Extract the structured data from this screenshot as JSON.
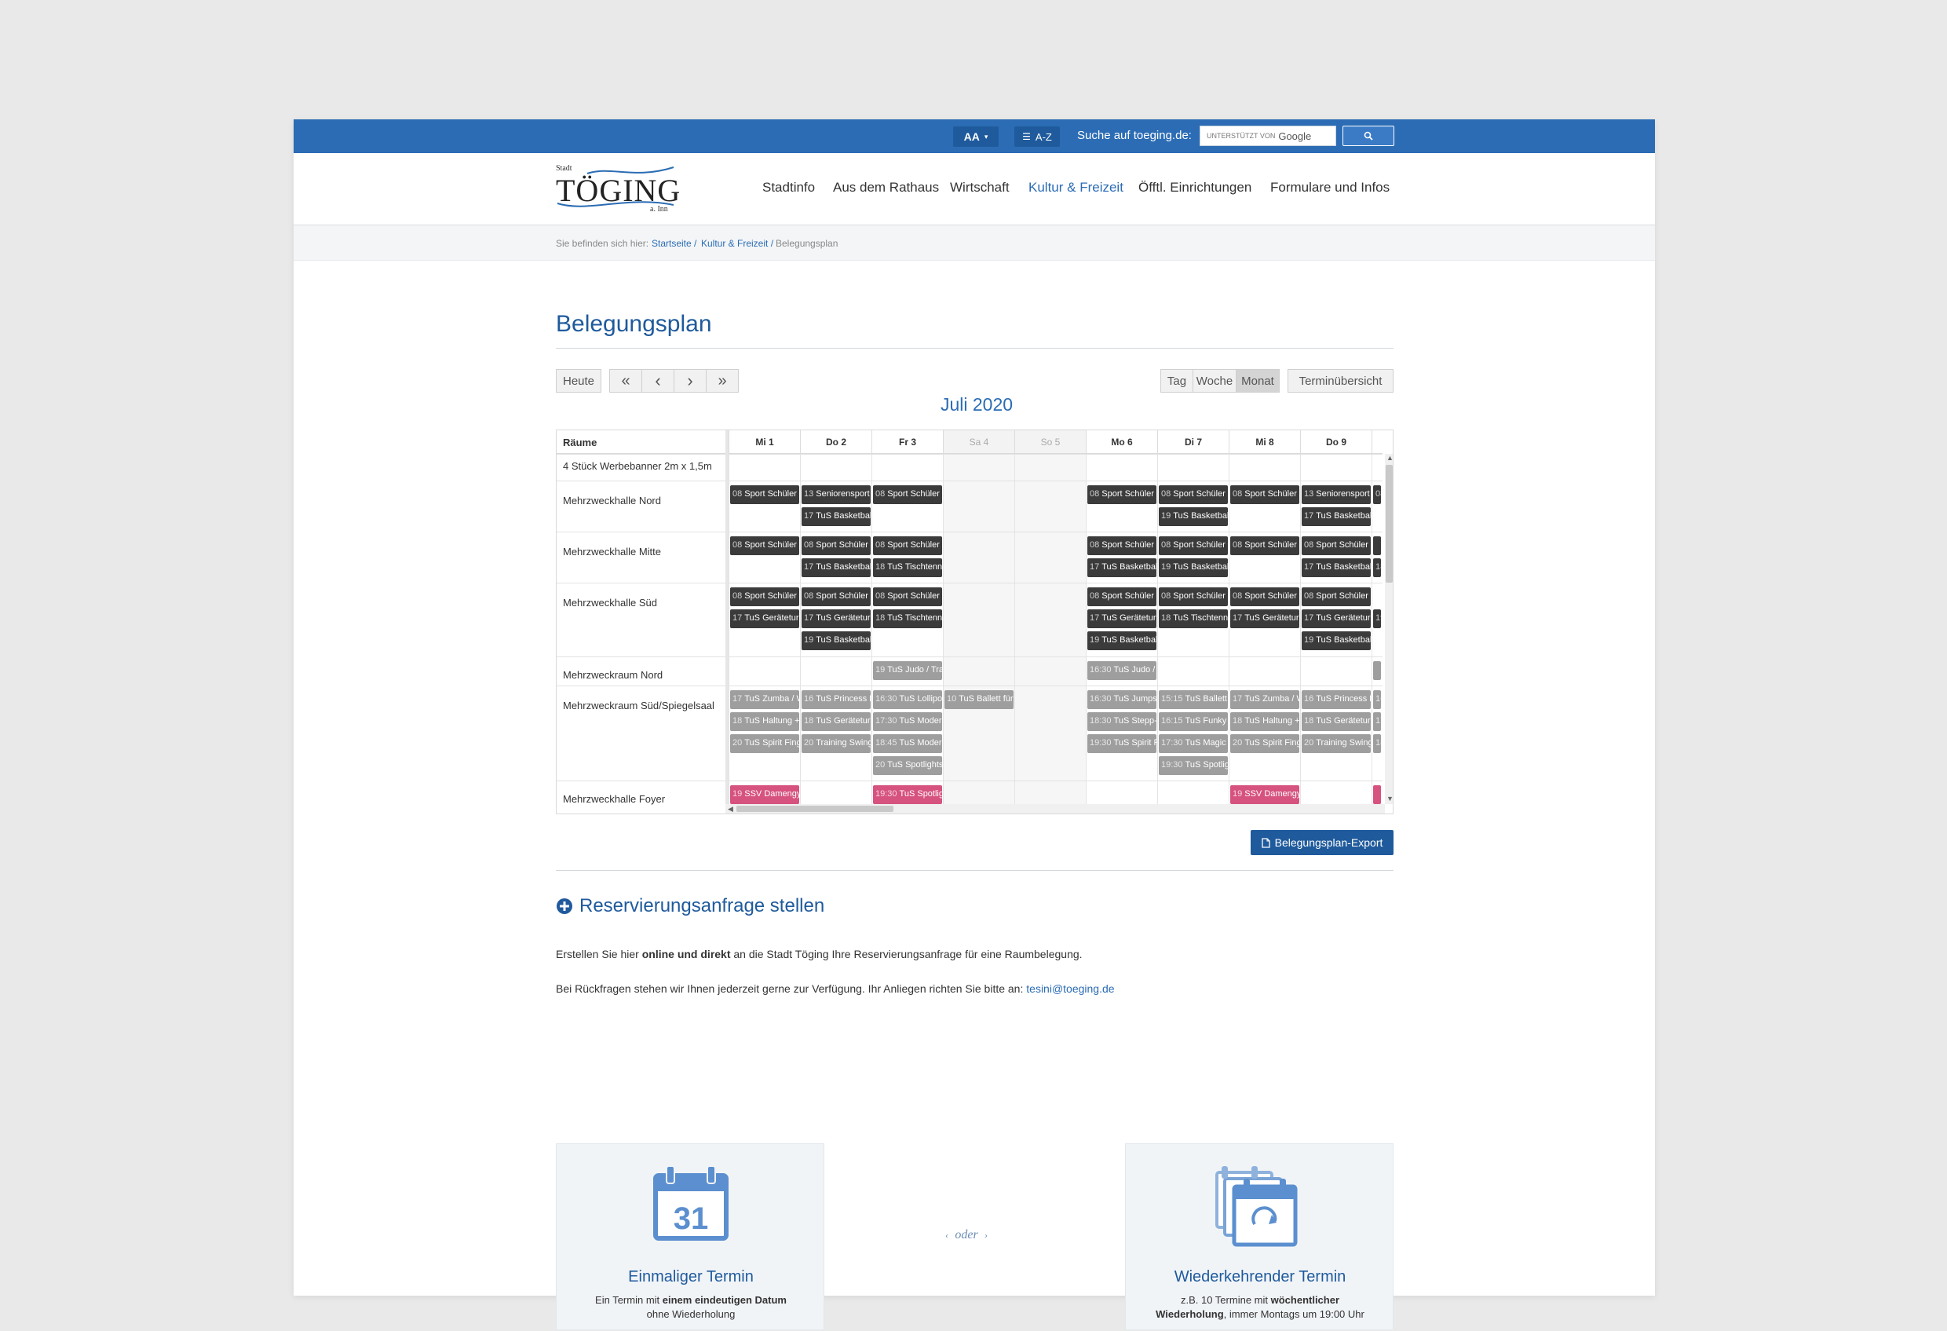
{
  "topbar": {
    "font_size_label": "AA",
    "az_label": "A-Z",
    "search_label": "Suche auf toeging.de:",
    "search_powered": "UNTERSTÜTZT VON",
    "search_brand": "Google"
  },
  "header": {
    "logo_top": "Stadt",
    "logo_name": "TÖGING",
    "logo_bottom": "a. Inn",
    "nav": [
      "Stadtinfo",
      "Aus dem Rathaus",
      "Wirtschaft",
      "Kultur & Freizeit",
      "Öfftl. Einrichtungen",
      "Formulare und Infos"
    ],
    "nav_active": "Kultur & Freizeit"
  },
  "breadcrumb": {
    "prefix": "Sie befinden sich hier:",
    "items": [
      "Startseite /",
      "Kultur & Freizeit /",
      "Belegungsplan"
    ]
  },
  "page": {
    "title": "Belegungsplan"
  },
  "calendar": {
    "today": "Heute",
    "nav_first": "«",
    "nav_prev": "‹",
    "nav_next": "›",
    "nav_last": "»",
    "view_day": "Tag",
    "view_week": "Woche",
    "view_month": "Monat",
    "overview": "Terminübersicht",
    "month_title": "Juli 2020",
    "rooms_header": "Räume",
    "days": [
      {
        "label": "Mi 1",
        "weekend": false
      },
      {
        "label": "Do 2",
        "weekend": false
      },
      {
        "label": "Fr 3",
        "weekend": false
      },
      {
        "label": "Sa 4",
        "weekend": true
      },
      {
        "label": "So 5",
        "weekend": true
      },
      {
        "label": "Mo 6",
        "weekend": false
      },
      {
        "label": "Di 7",
        "weekend": false
      },
      {
        "label": "Mi 8",
        "weekend": false
      },
      {
        "label": "Do 9",
        "weekend": false
      },
      {
        "label": "",
        "weekend": false
      }
    ],
    "rooms": [
      {
        "name": "4 Stück Werbebanner 2m x 1,5m"
      },
      {
        "name": "Mehrzweckhalle Nord"
      },
      {
        "name": "Mehrzweckhalle Mitte"
      },
      {
        "name": "Mehrzweckhalle Süd"
      },
      {
        "name": "Mehrzweckraum Nord"
      },
      {
        "name": "Mehrzweckraum Süd/Spiegelsaal"
      },
      {
        "name": "Mehrzweckhalle Foyer"
      }
    ],
    "events": [
      {
        "room": 1,
        "day": 0,
        "lane": 0,
        "time": "08",
        "text": "Sport Schüler Mittelschule",
        "style": "dark"
      },
      {
        "room": 1,
        "day": 1,
        "lane": 0,
        "time": "13",
        "text": "Seniorensport",
        "style": "dark"
      },
      {
        "room": 1,
        "day": 1,
        "lane": 1,
        "time": "17",
        "text": "TuS Basketball",
        "style": "dark"
      },
      {
        "room": 1,
        "day": 2,
        "lane": 0,
        "time": "08",
        "text": "Sport Schüler Mittelschule",
        "style": "dark"
      },
      {
        "room": 1,
        "day": 5,
        "lane": 0,
        "time": "08",
        "text": "Sport Schüler Mittelschule",
        "style": "dark"
      },
      {
        "room": 1,
        "day": 6,
        "lane": 0,
        "time": "08",
        "text": "Sport Schüler Mittelschule",
        "style": "dark"
      },
      {
        "room": 1,
        "day": 6,
        "lane": 1,
        "time": "19",
        "text": "TuS Basketball",
        "style": "dark"
      },
      {
        "room": 1,
        "day": 7,
        "lane": 0,
        "time": "08",
        "text": "Sport Schüler Mittelschule",
        "style": "dark"
      },
      {
        "room": 1,
        "day": 8,
        "lane": 0,
        "time": "13",
        "text": "Seniorensport",
        "style": "dark"
      },
      {
        "room": 1,
        "day": 8,
        "lane": 1,
        "time": "17",
        "text": "TuS Basketball",
        "style": "dark"
      },
      {
        "room": 1,
        "day": 9,
        "lane": 0,
        "time": "08",
        "text": "",
        "style": "dark"
      },
      {
        "room": 2,
        "day": 0,
        "lane": 0,
        "time": "08",
        "text": "Sport Schüler Mittelschule",
        "style": "dark"
      },
      {
        "room": 2,
        "day": 1,
        "lane": 0,
        "time": "08",
        "text": "Sport Schüler Mittelschule",
        "style": "dark"
      },
      {
        "room": 2,
        "day": 1,
        "lane": 1,
        "time": "17",
        "text": "TuS Basketball",
        "style": "dark"
      },
      {
        "room": 2,
        "day": 2,
        "lane": 0,
        "time": "08",
        "text": "Sport Schüler Mittelschule",
        "style": "dark"
      },
      {
        "room": 2,
        "day": 2,
        "lane": 1,
        "time": "18",
        "text": "TuS Tischtennis",
        "style": "dark"
      },
      {
        "room": 2,
        "day": 5,
        "lane": 0,
        "time": "08",
        "text": "Sport Schüler Mittelschule",
        "style": "dark"
      },
      {
        "room": 2,
        "day": 5,
        "lane": 1,
        "time": "17",
        "text": "TuS Basketball",
        "style": "dark"
      },
      {
        "room": 2,
        "day": 6,
        "lane": 0,
        "time": "08",
        "text": "Sport Schüler Mittelschule",
        "style": "dark"
      },
      {
        "room": 2,
        "day": 6,
        "lane": 1,
        "time": "19",
        "text": "TuS Basketball",
        "style": "dark"
      },
      {
        "room": 2,
        "day": 7,
        "lane": 0,
        "time": "08",
        "text": "Sport Schüler Mittelschule",
        "style": "dark"
      },
      {
        "room": 2,
        "day": 8,
        "lane": 0,
        "time": "08",
        "text": "Sport Schüler Mittelschule",
        "style": "dark"
      },
      {
        "room": 2,
        "day": 8,
        "lane": 1,
        "time": "17",
        "text": "TuS Basketball",
        "style": "dark"
      },
      {
        "room": 2,
        "day": 9,
        "lane": 0,
        "time": "",
        "text": "",
        "style": "dark"
      },
      {
        "room": 2,
        "day": 9,
        "lane": 1,
        "time": "18",
        "text": "",
        "style": "dark"
      },
      {
        "room": 3,
        "day": 0,
        "lane": 0,
        "time": "08",
        "text": "Sport Schüler Mittelschule",
        "style": "dark"
      },
      {
        "room": 3,
        "day": 0,
        "lane": 1,
        "time": "17",
        "text": "TuS Geräteturnen",
        "style": "dark"
      },
      {
        "room": 3,
        "day": 1,
        "lane": 0,
        "time": "08",
        "text": "Sport Schüler Mittelschule",
        "style": "dark"
      },
      {
        "room": 3,
        "day": 1,
        "lane": 1,
        "time": "17",
        "text": "TuS Geräteturnen",
        "style": "dark"
      },
      {
        "room": 3,
        "day": 1,
        "lane": 2,
        "time": "19",
        "text": "TuS Basketball",
        "style": "dark"
      },
      {
        "room": 3,
        "day": 2,
        "lane": 0,
        "time": "08",
        "text": "Sport Schüler Mittelschule",
        "style": "dark"
      },
      {
        "room": 3,
        "day": 2,
        "lane": 1,
        "time": "18",
        "text": "TuS Tischtennis",
        "style": "dark"
      },
      {
        "room": 3,
        "day": 5,
        "lane": 0,
        "time": "08",
        "text": "Sport Schüler Mittelschule",
        "style": "dark"
      },
      {
        "room": 3,
        "day": 5,
        "lane": 1,
        "time": "17",
        "text": "TuS Geräteturnen",
        "style": "dark"
      },
      {
        "room": 3,
        "day": 5,
        "lane": 2,
        "time": "19",
        "text": "TuS Basketball",
        "style": "dark"
      },
      {
        "room": 3,
        "day": 6,
        "lane": 0,
        "time": "08",
        "text": "Sport Schüler Mittelschule",
        "style": "dark"
      },
      {
        "room": 3,
        "day": 6,
        "lane": 1,
        "time": "18",
        "text": "TuS Tischtennis",
        "style": "dark"
      },
      {
        "room": 3,
        "day": 7,
        "lane": 0,
        "time": "08",
        "text": "Sport Schüler Mittelschule",
        "style": "dark"
      },
      {
        "room": 3,
        "day": 7,
        "lane": 1,
        "time": "17",
        "text": "TuS Geräteturnen",
        "style": "dark"
      },
      {
        "room": 3,
        "day": 8,
        "lane": 0,
        "time": "08",
        "text": "Sport Schüler Mittelschule",
        "style": "dark"
      },
      {
        "room": 3,
        "day": 8,
        "lane": 1,
        "time": "17",
        "text": "TuS Geräteturnen",
        "style": "dark"
      },
      {
        "room": 3,
        "day": 8,
        "lane": 2,
        "time": "19",
        "text": "TuS Basketball",
        "style": "dark"
      },
      {
        "room": 3,
        "day": 9,
        "lane": 1,
        "time": "19",
        "text": "",
        "style": "dark"
      },
      {
        "room": 4,
        "day": 2,
        "lane": 0,
        "time": "19",
        "text": "TuS Judo / Training",
        "style": "grey"
      },
      {
        "room": 4,
        "day": 5,
        "lane": 0,
        "time": "16:30",
        "text": "TuS Judo / Training",
        "style": "grey"
      },
      {
        "room": 4,
        "day": 9,
        "lane": 0,
        "time": "",
        "text": "",
        "style": "grey"
      },
      {
        "room": 5,
        "day": 0,
        "lane": 0,
        "time": "17",
        "text": "TuS Zumba / Workout",
        "style": "grey"
      },
      {
        "room": 5,
        "day": 0,
        "lane": 1,
        "time": "18",
        "text": "TuS Haltung + Gymnastik",
        "style": "grey"
      },
      {
        "room": 5,
        "day": 0,
        "lane": 2,
        "time": "20",
        "text": "TuS Spirit Fingers",
        "style": "grey"
      },
      {
        "room": 5,
        "day": 1,
        "lane": 0,
        "time": "16",
        "text": "TuS Princess Dance",
        "style": "grey"
      },
      {
        "room": 5,
        "day": 1,
        "lane": 1,
        "time": "18",
        "text": "TuS Geräteturnen",
        "style": "grey"
      },
      {
        "room": 5,
        "day": 1,
        "lane": 2,
        "time": "20",
        "text": "Training Swing",
        "style": "grey"
      },
      {
        "room": 5,
        "day": 2,
        "lane": 0,
        "time": "16:30",
        "text": "TuS Lollipops",
        "style": "grey"
      },
      {
        "room": 5,
        "day": 2,
        "lane": 1,
        "time": "17:30",
        "text": "TuS Modern Dance",
        "style": "grey"
      },
      {
        "room": 5,
        "day": 2,
        "lane": 2,
        "time": "18:45",
        "text": "TuS Modern Dance",
        "style": "grey"
      },
      {
        "room": 5,
        "day": 2,
        "lane": 3,
        "time": "20",
        "text": "TuS Spotlights",
        "style": "grey"
      },
      {
        "room": 5,
        "day": 3,
        "lane": 0,
        "time": "10",
        "text": "TuS Ballett für Kinder",
        "style": "grey"
      },
      {
        "room": 5,
        "day": 5,
        "lane": 0,
        "time": "16:30",
        "text": "TuS Jumpstyle",
        "style": "grey"
      },
      {
        "room": 5,
        "day": 5,
        "lane": 1,
        "time": "18:30",
        "text": "TuS Stepp-Gruppe",
        "style": "grey"
      },
      {
        "room": 5,
        "day": 5,
        "lane": 2,
        "time": "19:30",
        "text": "TuS Spirit Fingers",
        "style": "grey"
      },
      {
        "room": 5,
        "day": 6,
        "lane": 0,
        "time": "15:15",
        "text": "TuS Ballett Kinder",
        "style": "grey"
      },
      {
        "room": 5,
        "day": 6,
        "lane": 1,
        "time": "16:15",
        "text": "TuS Funky Feet",
        "style": "grey"
      },
      {
        "room": 5,
        "day": 6,
        "lane": 2,
        "time": "17:30",
        "text": "TuS Magic Feet",
        "style": "grey"
      },
      {
        "room": 5,
        "day": 6,
        "lane": 3,
        "time": "19:30",
        "text": "TuS Spotlights",
        "style": "grey"
      },
      {
        "room": 5,
        "day": 7,
        "lane": 0,
        "time": "17",
        "text": "TuS Zumba / Workout",
        "style": "grey"
      },
      {
        "room": 5,
        "day": 7,
        "lane": 1,
        "time": "18",
        "text": "TuS Haltung + Gymnastik",
        "style": "grey"
      },
      {
        "room": 5,
        "day": 7,
        "lane": 2,
        "time": "20",
        "text": "TuS Spirit Fingers",
        "style": "grey"
      },
      {
        "room": 5,
        "day": 8,
        "lane": 0,
        "time": "16",
        "text": "TuS Princess Dance",
        "style": "grey"
      },
      {
        "room": 5,
        "day": 8,
        "lane": 1,
        "time": "18",
        "text": "TuS Geräteturnen",
        "style": "grey"
      },
      {
        "room": 5,
        "day": 8,
        "lane": 2,
        "time": "20",
        "text": "Training Swing",
        "style": "grey"
      },
      {
        "room": 5,
        "day": 9,
        "lane": 0,
        "time": "16",
        "text": "",
        "style": "grey"
      },
      {
        "room": 5,
        "day": 9,
        "lane": 1,
        "time": "17",
        "text": "",
        "style": "grey"
      },
      {
        "room": 5,
        "day": 9,
        "lane": 2,
        "time": "18",
        "text": "",
        "style": "grey"
      },
      {
        "room": 6,
        "day": 0,
        "lane": 0,
        "time": "19",
        "text": "SSV Damengymnastik",
        "style": "pink"
      },
      {
        "room": 6,
        "day": 2,
        "lane": 0,
        "time": "19:30",
        "text": "TuS Spotlights",
        "style": "pink"
      },
      {
        "room": 6,
        "day": 7,
        "lane": 0,
        "time": "19",
        "text": "SSV Damengymnastik",
        "style": "pink"
      },
      {
        "room": 6,
        "day": 9,
        "lane": 0,
        "time": "",
        "text": "",
        "style": "pink"
      }
    ]
  },
  "export": {
    "label": "Belegungsplan-Export"
  },
  "reservation": {
    "heading": "Reservierungsanfrage stellen",
    "p1_before": "Erstellen Sie hier ",
    "p1_bold": "online und direkt",
    "p1_after": " an die Stadt Töging Ihre Reservierungsanfrage für eine Raumbelegung.",
    "p2_before": "Bei Rückfragen stehen wir Ihnen jederzeit gerne zur Verfügung. Ihr Anliegen richten Sie bitte an: ",
    "p2_email": "tesini@toeging.de",
    "card_single": {
      "icon_number": "31",
      "title": "Einmaliger Termin",
      "desc_before": "Ein Termin mit ",
      "desc_bold": "einem eindeutigen Datum",
      "desc_after": "ohne Wiederholung"
    },
    "oder": "oder",
    "card_recurring": {
      "title": "Wiederkehrender Termin",
      "desc_before": "z.B. 10 Termine mit ",
      "desc_bold1": "wöchentlicher",
      "desc_bold2": "Wiederholung",
      "desc_after": ", immer Montags um 19:00 Uhr"
    }
  },
  "colors": {
    "brand_blue": "#2b6cb4",
    "dark_blue": "#1f5a9c",
    "event_dark": "#3b3b3b",
    "event_grey": "#9e9e9e",
    "event_pink": "#d6527f"
  }
}
